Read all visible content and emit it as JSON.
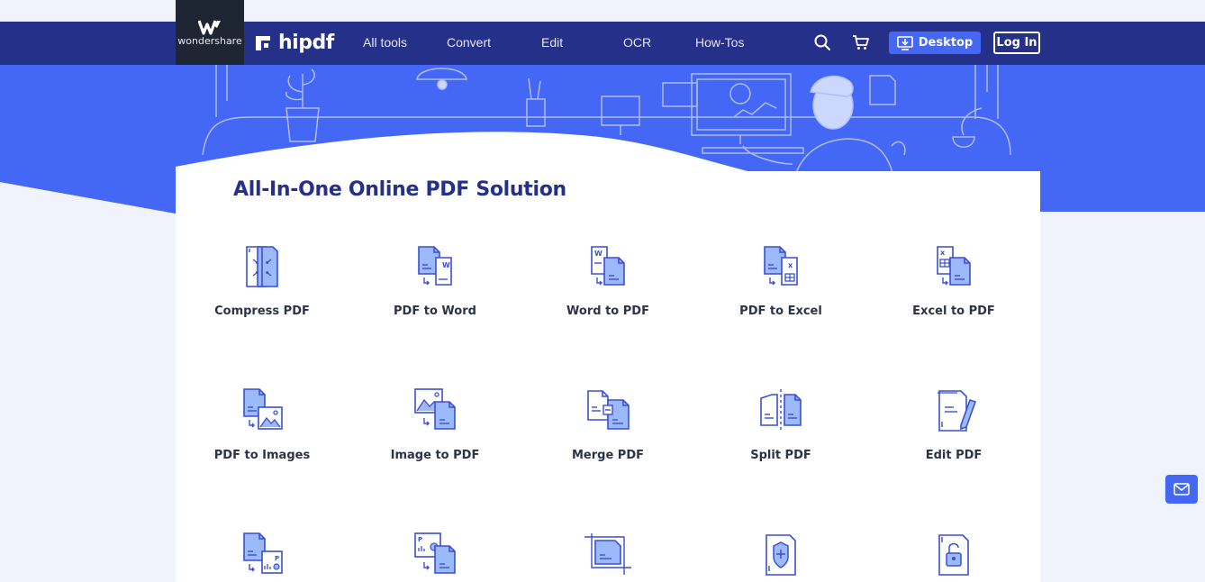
{
  "header": {
    "wondershare_label": "wondershare",
    "brand_name": "hipdf",
    "nav_links": [
      "All tools",
      "Convert",
      "Edit",
      "OCR",
      "How-Tos"
    ],
    "desktop_label": "Desktop",
    "login_label": "Log In",
    "icons": [
      "search-icon",
      "cart-icon",
      "download-icon"
    ]
  },
  "main": {
    "title": "All-In-One Online PDF Solution",
    "tools": [
      {
        "label": "Compress PDF",
        "icon": "compress-icon"
      },
      {
        "label": "PDF to Word",
        "icon": "pdf-to-word-icon"
      },
      {
        "label": "Word to PDF",
        "icon": "word-to-pdf-icon"
      },
      {
        "label": "PDF to Excel",
        "icon": "pdf-to-excel-icon"
      },
      {
        "label": "Excel to PDF",
        "icon": "excel-to-pdf-icon"
      },
      {
        "label": "PDF to Images",
        "icon": "pdf-to-images-icon"
      },
      {
        "label": "Image to PDF",
        "icon": "image-to-pdf-icon"
      },
      {
        "label": "Merge PDF",
        "icon": "merge-icon"
      },
      {
        "label": "Split PDF",
        "icon": "split-icon"
      },
      {
        "label": "Edit PDF",
        "icon": "edit-icon"
      }
    ],
    "partial_tools_icons": [
      "pdf-to-ppt-icon",
      "ppt-to-pdf-icon",
      "crop-icon",
      "protect-icon",
      "unlock-icon"
    ]
  },
  "colors": {
    "nav_bg": "#253088",
    "hero_bg": "#4468f5",
    "accent": "#4468f5",
    "title": "#253088",
    "icon_fill": "#9bb9fb",
    "icon_stroke": "#3b4fd2"
  },
  "floating": {
    "icon": "mail-icon"
  }
}
